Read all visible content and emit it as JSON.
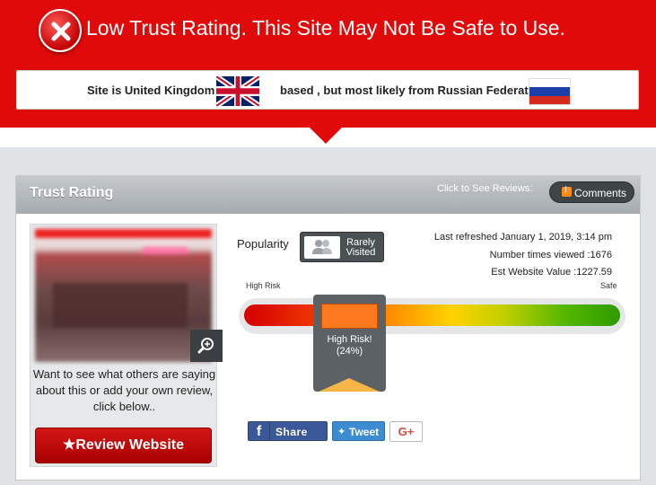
{
  "banner": {
    "title": "Low Trust Rating. This Site May Not Be Safe to Use.",
    "location_prefix": "Site is United Kingdom",
    "location_suffix": "based , but most likely from Russian Federation",
    "icon": "close-icon",
    "color": "#e10a0a"
  },
  "panel": {
    "title": "Trust Rating",
    "click_to_see": "Click to See Reviews:",
    "comments_label": "Comments",
    "comments_badge": "!"
  },
  "site_card": {
    "description": "Want to see what others are saying about this or add your own review, click below..",
    "review_button": "Review Website",
    "review_star": "★"
  },
  "popularity": {
    "label": "Popularity",
    "value": "Rarely Visited"
  },
  "meta": {
    "last_refreshed": "Last refreshed January 1, 2019, 3:14 pm",
    "times_viewed": "Number times viewed :1676",
    "est_value": "Est Website Value :1227.59"
  },
  "gauge": {
    "low_label": "High Risk",
    "high_label": "Safe",
    "status": "High Risk!",
    "percent": "(24%)",
    "fraction": 0.24
  },
  "share": {
    "facebook_label": "Share",
    "facebook_icon": "f",
    "twitter_label": "Tweet",
    "google_label": "G+"
  }
}
